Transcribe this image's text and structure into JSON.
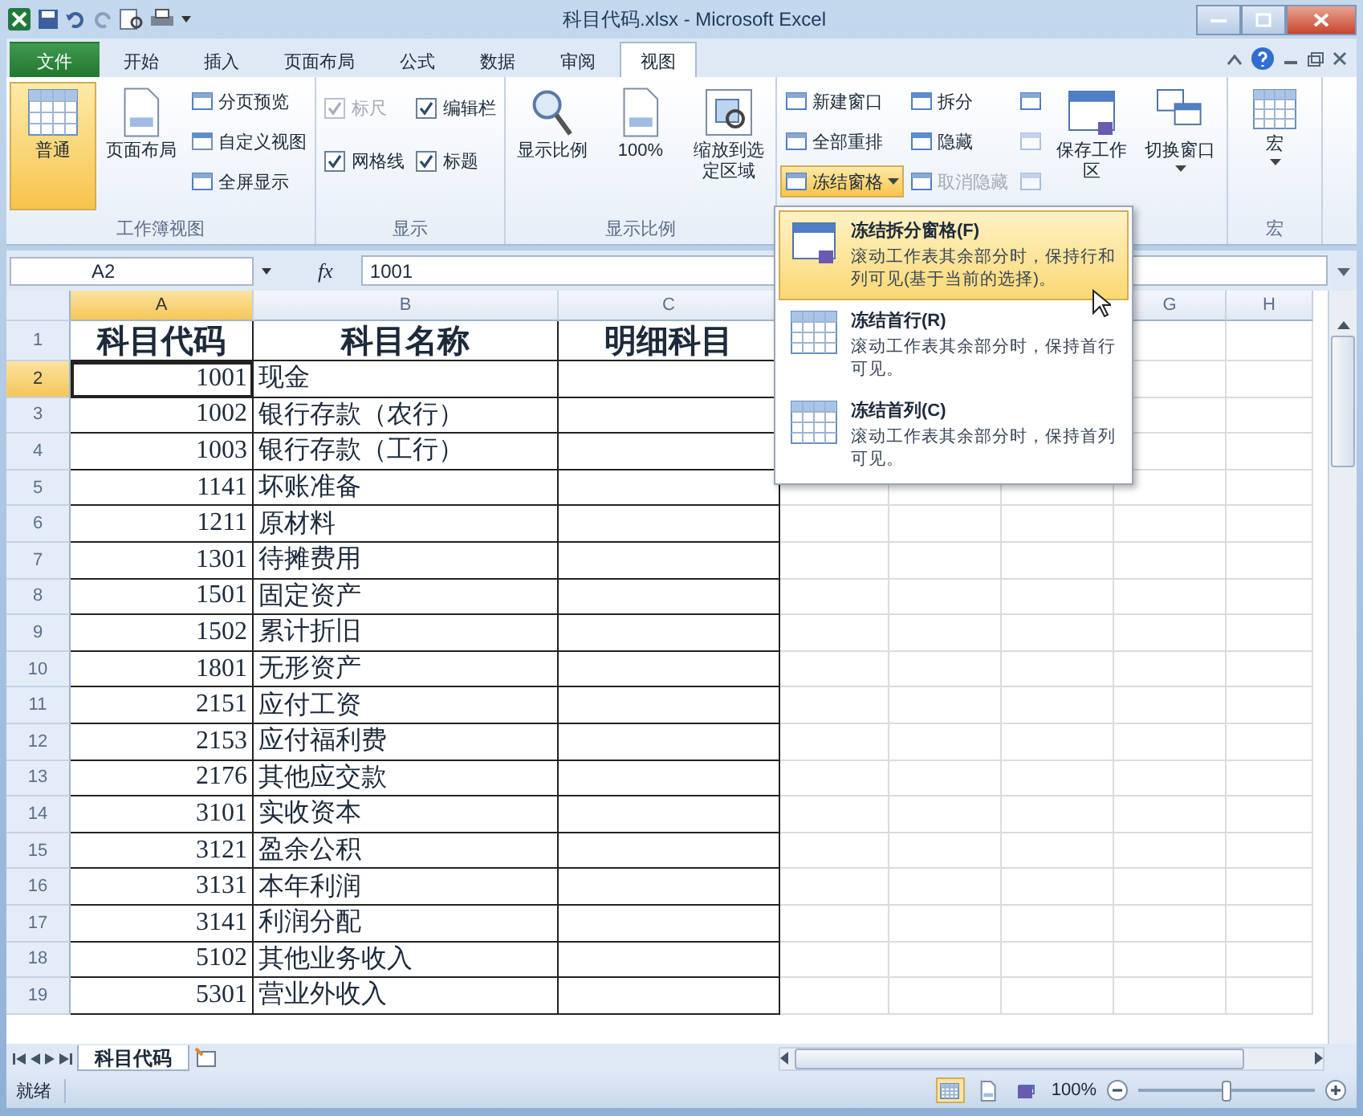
{
  "window": {
    "title": "科目代码.xlsx - Microsoft Excel"
  },
  "ribbon_tabs": [
    {
      "label": "文件",
      "kind": "file",
      "selected": false
    },
    {
      "label": "开始",
      "kind": "tab",
      "selected": false
    },
    {
      "label": "插入",
      "kind": "tab",
      "selected": false
    },
    {
      "label": "页面布局",
      "kind": "tab",
      "selected": false
    },
    {
      "label": "公式",
      "kind": "tab",
      "selected": false
    },
    {
      "label": "数据",
      "kind": "tab",
      "selected": false
    },
    {
      "label": "审阅",
      "kind": "tab",
      "selected": false
    },
    {
      "label": "视图",
      "kind": "tab",
      "selected": true
    }
  ],
  "ribbon_groups": [
    {
      "label": "工作簿视图",
      "items": [
        {
          "kind": "large",
          "label": "普通",
          "selected": true
        },
        {
          "kind": "large",
          "label": "页面布局",
          "selected": false
        },
        {
          "kind": "stack",
          "items": [
            {
              "kind": "small",
              "label": "分页预览"
            },
            {
              "kind": "small",
              "label": "自定义视图"
            },
            {
              "kind": "small",
              "label": "全屏显示"
            }
          ]
        }
      ]
    },
    {
      "label": "显示",
      "items": [
        {
          "kind": "stack",
          "items": [
            {
              "kind": "check",
              "label": "标尺",
              "checked": true,
              "disabled": true
            },
            {
              "kind": "check",
              "label": "网格线",
              "checked": true,
              "disabled": false
            }
          ]
        },
        {
          "kind": "stack",
          "items": [
            {
              "kind": "check",
              "label": "编辑栏",
              "checked": true,
              "disabled": false
            },
            {
              "kind": "check",
              "label": "标题",
              "checked": true,
              "disabled": false
            }
          ]
        }
      ]
    },
    {
      "label": "显示比例",
      "items": [
        {
          "kind": "large",
          "label": "显示比例"
        },
        {
          "kind": "large",
          "label": "100%"
        },
        {
          "kind": "large",
          "label": "缩放到选定区域"
        }
      ]
    },
    {
      "items": [
        {
          "kind": "stack",
          "items": [
            {
              "kind": "small",
              "label": "新建窗口",
              "expanded": false,
              "disabled": false
            },
            {
              "kind": "small",
              "label": "全部重排",
              "expanded": false,
              "disabled": false
            },
            {
              "kind": "small",
              "label": "冻结窗格",
              "menu": true,
              "expanded": true,
              "disabled": false
            }
          ]
        },
        {
          "kind": "stack",
          "items": [
            {
              "kind": "small",
              "label": "拆分",
              "disabled": false
            },
            {
              "kind": "small",
              "label": "隐藏",
              "disabled": false
            },
            {
              "kind": "small",
              "label": "取消隐藏",
              "disabled": true
            }
          ]
        },
        {
          "kind": "stack",
          "items": [
            {
              "kind": "icon",
              "disabled": false
            },
            {
              "kind": "icon",
              "disabled": true
            },
            {
              "kind": "icon",
              "disabled": true
            }
          ]
        },
        {
          "kind": "large",
          "label": "保存工作区"
        },
        {
          "kind": "large",
          "label": "切换窗口",
          "menu": true
        }
      ]
    },
    {
      "label": "宏",
      "items": [
        {
          "kind": "large",
          "label": "宏",
          "menu": true
        }
      ]
    }
  ],
  "formula_bar": {
    "name_box": "A2",
    "function_label": "fx",
    "formula": "1001"
  },
  "sheet": {
    "columns": [
      {
        "label": "A",
        "selected": true
      },
      {
        "label": "B",
        "selected": false
      },
      {
        "label": "C",
        "selected": false
      },
      {},
      {},
      {},
      {
        "label": "G",
        "selected": false
      },
      {
        "label": "H",
        "selected": false
      }
    ],
    "rows": [
      {
        "header": "1",
        "kind": "heading",
        "selected": false,
        "cells": [
          "科目代码",
          "科目名称",
          "明细科目"
        ]
      },
      {
        "header": "2",
        "kind": "data",
        "selected": true,
        "cells": [
          "1001",
          "现金"
        ]
      },
      {
        "header": "3",
        "kind": "data",
        "selected": false,
        "cells": [
          "1002",
          "银行存款（农行）"
        ]
      },
      {
        "header": "4",
        "kind": "data",
        "selected": false,
        "cells": [
          "1003",
          "银行存款（工行）"
        ]
      },
      {
        "header": "5",
        "kind": "data",
        "selected": false,
        "cells": [
          "1141",
          "坏账准备"
        ]
      },
      {
        "header": "6",
        "kind": "data",
        "selected": false,
        "cells": [
          "1211",
          "原材料"
        ]
      },
      {
        "header": "7",
        "kind": "data",
        "selected": false,
        "cells": [
          "1301",
          "待摊费用"
        ]
      },
      {
        "header": "8",
        "kind": "data",
        "selected": false,
        "cells": [
          "1501",
          "固定资产"
        ]
      },
      {
        "header": "9",
        "kind": "data",
        "selected": false,
        "cells": [
          "1502",
          "累计折旧"
        ]
      },
      {
        "header": "10",
        "kind": "data",
        "selected": false,
        "cells": [
          "1801",
          "无形资产"
        ]
      },
      {
        "header": "11",
        "kind": "data",
        "selected": false,
        "cells": [
          "2151",
          "应付工资"
        ]
      },
      {
        "header": "12",
        "kind": "data",
        "selected": false,
        "cells": [
          "2153",
          "应付福利费"
        ]
      },
      {
        "header": "13",
        "kind": "data",
        "selected": false,
        "cells": [
          "2176",
          "其他应交款"
        ]
      },
      {
        "header": "14",
        "kind": "data",
        "selected": false,
        "cells": [
          "3101",
          "实收资本"
        ]
      },
      {
        "header": "15",
        "kind": "data",
        "selected": false,
        "cells": [
          "3121",
          "盈余公积"
        ]
      },
      {
        "header": "16",
        "kind": "data",
        "selected": false,
        "cells": [
          "3131",
          "本年利润"
        ]
      },
      {
        "header": "17",
        "kind": "data",
        "selected": false,
        "cells": [
          "3141",
          "利润分配"
        ]
      },
      {
        "header": "18",
        "kind": "data",
        "selected": false,
        "cells": [
          "5102",
          "其他业务收入"
        ]
      },
      {
        "header": "19",
        "kind": "data",
        "selected": false,
        "cells": [
          "5301",
          "营业外收入"
        ]
      }
    ]
  },
  "freeze_menu": {
    "items": [
      {
        "title": "冻结拆分窗格(F)",
        "description": "滚动工作表其余部分时，保持行和列可见(基于当前的选择)。",
        "selected": true
      },
      {
        "title": "冻结首行(R)",
        "description": "滚动工作表其余部分时，保持首行可见。",
        "selected": false
      },
      {
        "title": "冻结首列(C)",
        "description": "滚动工作表其余部分时，保持首列可见。",
        "selected": false
      }
    ]
  },
  "sheet_tabs": [
    {
      "label": "科目代码",
      "selected": true
    }
  ],
  "status_bar": {
    "text": "就绪",
    "view_buttons": [
      {
        "selected": true
      },
      {
        "selected": false
      },
      {
        "selected": false
      }
    ],
    "zoom": "100%",
    "zoom_slider": {
      "level": 0.5
    }
  }
}
